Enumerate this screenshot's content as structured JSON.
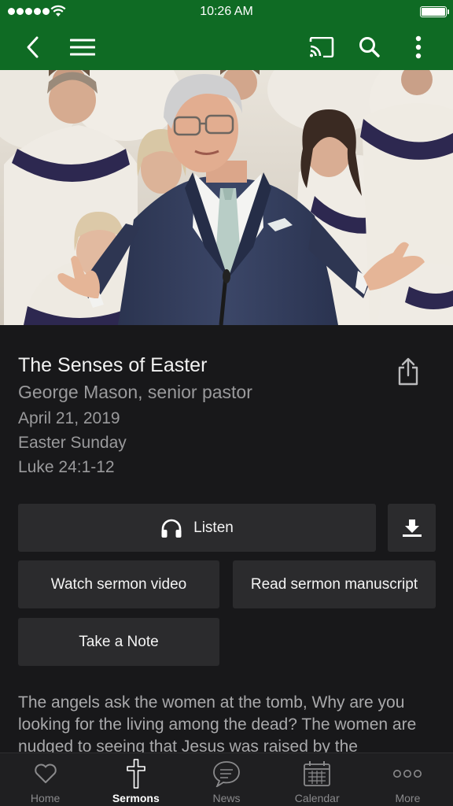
{
  "status_bar": {
    "time": "10:26 AM"
  },
  "toolbar": {
    "icons": [
      "back-icon",
      "menu-icon",
      "cast-icon",
      "search-icon",
      "more-vertical-icon"
    ],
    "background": "#0f6b24"
  },
  "sermon": {
    "title": "The Senses of Easter",
    "speaker": "George Mason, senior pastor",
    "date": "April 21, 2019",
    "occasion": "Easter Sunday",
    "scripture": "Luke 24:1-12",
    "description": "The angels ask the women at the tomb, Why are you looking for the living among the dead? The women are nudged to seeing that Jesus was raised by the"
  },
  "actions": {
    "listen_label": "Listen",
    "watch_label": "Watch sermon video",
    "read_label": "Read sermon manuscript",
    "note_label": "Take a Note"
  },
  "tabs": [
    {
      "label": "Home",
      "icon": "heart-icon",
      "active": false
    },
    {
      "label": "Sermons",
      "icon": "cross-icon",
      "active": true
    },
    {
      "label": "News",
      "icon": "chat-bubble-icon",
      "active": false
    },
    {
      "label": "Calendar",
      "icon": "calendar-icon",
      "active": false
    },
    {
      "label": "More",
      "icon": "more-dots-icon",
      "active": false
    }
  ]
}
